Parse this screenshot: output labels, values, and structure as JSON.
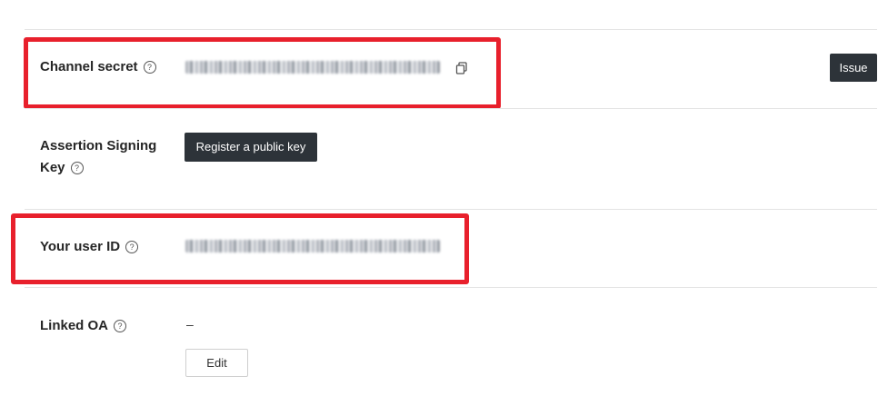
{
  "rows": {
    "channel_secret": {
      "label": "Channel secret",
      "help_icon": "question-circle-icon",
      "copy_icon": "copy-icon",
      "issue_label": "Issue"
    },
    "assertion_key": {
      "label_line1": "Assertion Signing",
      "label_line2": "Key",
      "help_icon": "question-circle-icon",
      "register_label": "Register a public key"
    },
    "user_id": {
      "label": "Your user ID",
      "help_icon": "question-circle-icon"
    },
    "linked_oa": {
      "label": "Linked OA",
      "help_icon": "question-circle-icon",
      "value": "–",
      "edit_label": "Edit"
    }
  },
  "colors": {
    "highlight": "#e8202c",
    "dark_button": "#2d3339"
  }
}
